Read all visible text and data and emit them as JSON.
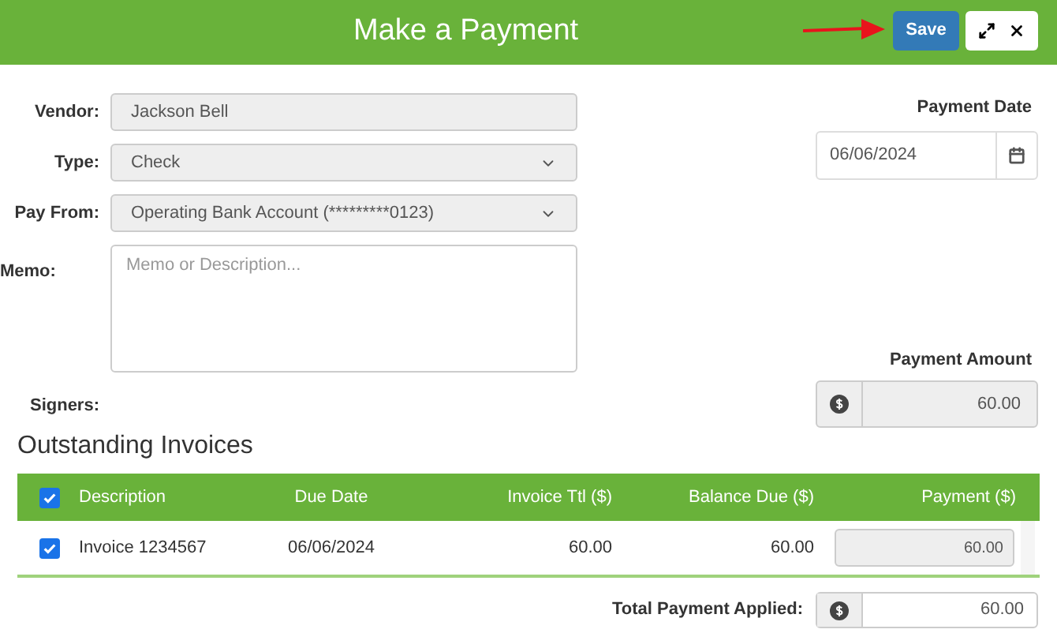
{
  "header": {
    "title": "Make a Payment",
    "save_button": "Save"
  },
  "form": {
    "vendor": {
      "label": "Vendor:",
      "value": "Jackson Bell"
    },
    "type": {
      "label": "Type:",
      "value": "Check"
    },
    "pay_from": {
      "label": "Pay From:",
      "value": "Operating Bank Account (*********0123)"
    },
    "memo": {
      "label": "Memo:",
      "placeholder": "Memo or Description..."
    },
    "signers": {
      "label": "Signers:"
    }
  },
  "payment_date": {
    "label": "Payment Date",
    "value": "06/06/2024"
  },
  "payment_amount": {
    "label": "Payment Amount",
    "value": "60.00"
  },
  "invoices": {
    "title": "Outstanding Invoices",
    "all_checked": true,
    "columns": [
      "Description",
      "Due Date",
      "Invoice Ttl ($)",
      "Balance Due ($)",
      "Payment ($)"
    ],
    "rows": [
      {
        "checked": true,
        "description": "Invoice 1234567",
        "due_date": "06/06/2024",
        "invoice_total": "60.00",
        "balance_due": "60.00",
        "payment": "60.00"
      }
    ]
  },
  "total": {
    "label": "Total Payment Applied:",
    "value": "60.00"
  }
}
